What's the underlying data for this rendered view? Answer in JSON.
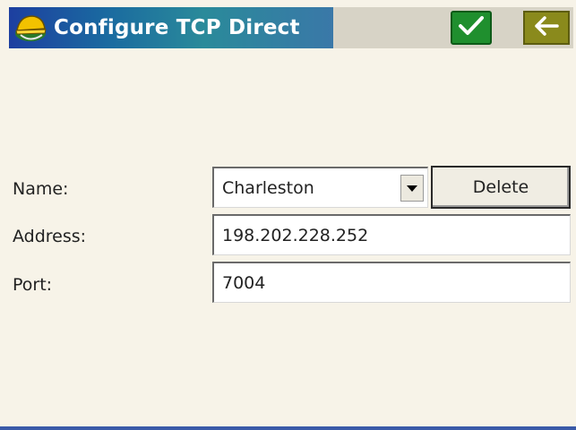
{
  "titlebar": {
    "title": "Configure TCP Direct",
    "app_icon": "survey-helmet-icon",
    "ok_icon": "checkmark-icon",
    "back_icon": "back-arrow-icon",
    "ok_color": "#1f8f2e",
    "back_color": "#8a8a1c"
  },
  "form": {
    "name_label": "Name:",
    "name_value": "Charleston",
    "delete_label": "Delete",
    "address_label": "Address:",
    "address_value": "198.202.228.252",
    "port_label": "Port:",
    "port_value": "7004"
  }
}
